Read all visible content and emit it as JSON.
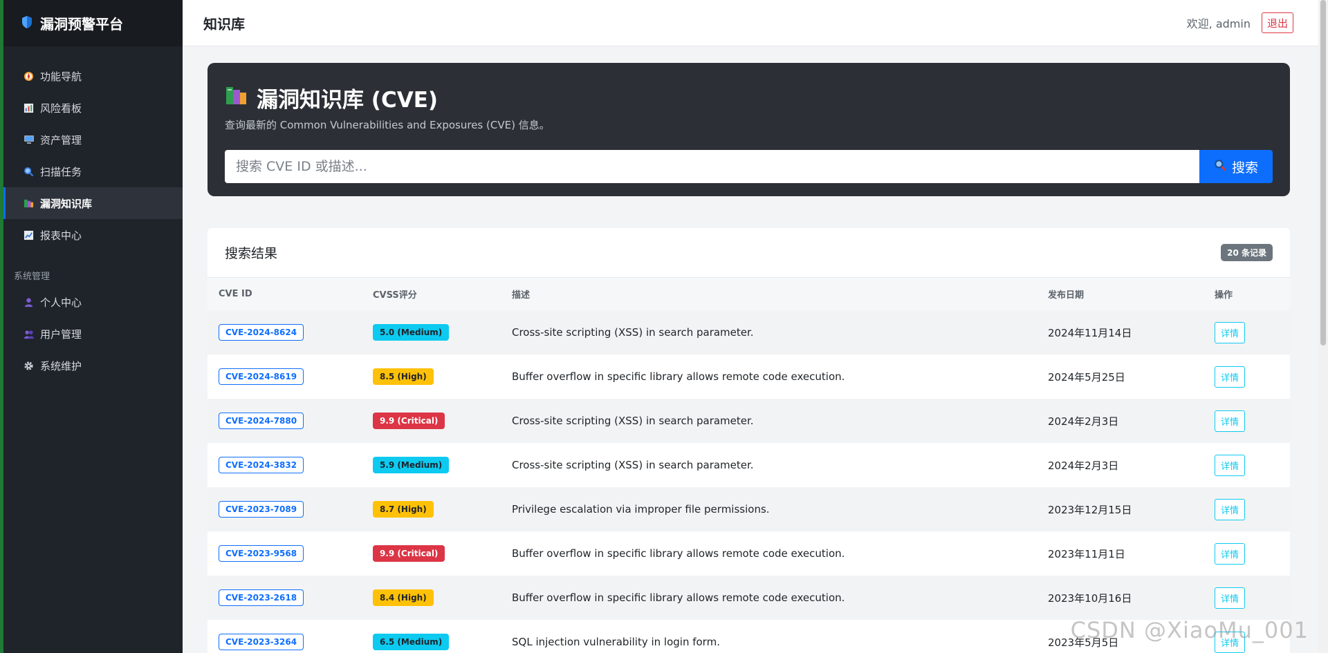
{
  "brand": {
    "title": "漏洞预警平台"
  },
  "sidebar": {
    "items": [
      {
        "label": "功能导航",
        "icon": "compass-icon",
        "active": false
      },
      {
        "label": "风险看板",
        "icon": "chart-icon",
        "active": false
      },
      {
        "label": "资产管理",
        "icon": "computer-icon",
        "active": false
      },
      {
        "label": "扫描任务",
        "icon": "magnifier-icon",
        "active": false
      },
      {
        "label": "漏洞知识库",
        "icon": "books-icon",
        "active": true
      },
      {
        "label": "报表中心",
        "icon": "trend-icon",
        "active": false
      }
    ],
    "section_label": "系统管理",
    "system_items": [
      {
        "label": "个人中心",
        "icon": "user-icon"
      },
      {
        "label": "用户管理",
        "icon": "users-icon"
      },
      {
        "label": "系统维护",
        "icon": "gear-icon"
      }
    ]
  },
  "topbar": {
    "title": "知识库",
    "welcome": "欢迎, admin",
    "logout": "退出"
  },
  "hero": {
    "title": "漏洞知识库 (CVE)",
    "subtitle": "查询最新的 Common Vulnerabilities and Exposures (CVE) 信息。",
    "search_placeholder": "搜索 CVE ID 或描述...",
    "search_button": "搜索"
  },
  "results": {
    "title": "搜索结果",
    "count": "20 条记录",
    "columns": [
      "CVE ID",
      "CVSS评分",
      "描述",
      "发布日期",
      "操作"
    ],
    "rows": [
      {
        "cve": "CVE-2024-8624",
        "cvss": "5.0 (Medium)",
        "severity": "medium",
        "description": "Cross-site scripting (XSS) in search parameter.",
        "date": "2024年11月14日",
        "action": "详情"
      },
      {
        "cve": "CVE-2024-8619",
        "cvss": "8.5 (High)",
        "severity": "high",
        "description": "Buffer overflow in specific library allows remote code execution.",
        "date": "2024年5月25日",
        "action": "详情"
      },
      {
        "cve": "CVE-2024-7880",
        "cvss": "9.9 (Critical)",
        "severity": "critical",
        "description": "Cross-site scripting (XSS) in search parameter.",
        "date": "2024年2月3日",
        "action": "详情"
      },
      {
        "cve": "CVE-2024-3832",
        "cvss": "5.9 (Medium)",
        "severity": "medium",
        "description": "Cross-site scripting (XSS) in search parameter.",
        "date": "2024年2月3日",
        "action": "详情"
      },
      {
        "cve": "CVE-2023-7089",
        "cvss": "8.7 (High)",
        "severity": "high",
        "description": "Privilege escalation via improper file permissions.",
        "date": "2023年12月15日",
        "action": "详情"
      },
      {
        "cve": "CVE-2023-9568",
        "cvss": "9.9 (Critical)",
        "severity": "critical",
        "description": "Buffer overflow in specific library allows remote code execution.",
        "date": "2023年11月1日",
        "action": "详情"
      },
      {
        "cve": "CVE-2023-2618",
        "cvss": "8.4 (High)",
        "severity": "high",
        "description": "Buffer overflow in specific library allows remote code execution.",
        "date": "2023年10月16日",
        "action": "详情"
      },
      {
        "cve": "CVE-2023-3264",
        "cvss": "6.5 (Medium)",
        "severity": "medium",
        "description": "SQL injection vulnerability in login form.",
        "date": "2023年5月5日",
        "action": "详情"
      }
    ]
  },
  "severity_colors": {
    "medium": {
      "bg": "#0dcaf0",
      "fg": "#1f232a"
    },
    "high": {
      "bg": "#ffc107",
      "fg": "#1f232a"
    },
    "critical": {
      "bg": "#dc3545",
      "fg": "#ffffff"
    }
  },
  "colors": {
    "primary": "#0d6efd",
    "sidebar_bg": "#1f232a",
    "hero_bg": "#2c3036",
    "danger": "#dc3545",
    "info": "#0dcaf0"
  },
  "watermark": "CSDN @XiaoMu_001"
}
